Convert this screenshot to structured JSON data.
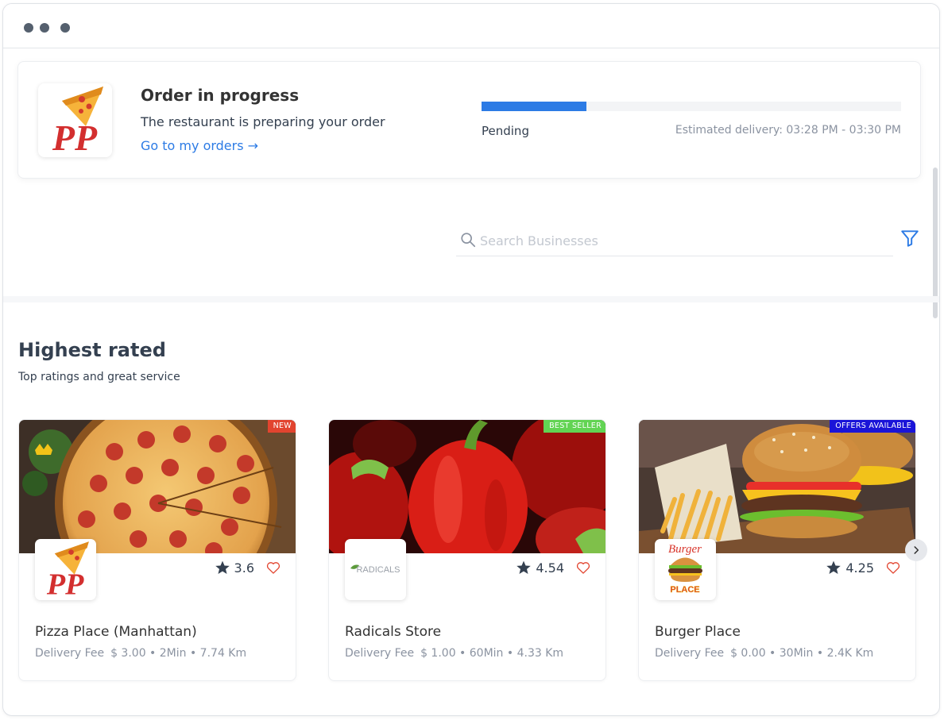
{
  "window": {
    "controls": [
      "window-dot-1",
      "window-dot-2",
      "window-dot-3"
    ]
  },
  "order": {
    "logo_text": "PP",
    "title": "Order in progress",
    "subtitle": "The restaurant is preparing your order",
    "link": "Go to my orders →",
    "progress": 0.25,
    "status": "Pending",
    "eta": "Estimated delivery: 03:28 PM - 03:30 PM",
    "colors": {
      "accent": "#2c7be5",
      "logo_red": "#d32f2f"
    }
  },
  "search": {
    "placeholder": "Search Businesses",
    "value": ""
  },
  "section": {
    "title": "Highest rated",
    "subtitle": "Top ratings and great service"
  },
  "businesses": [
    {
      "name": "Pizza Place (Manhattan)",
      "badge": "NEW",
      "badge_color": "#e2442f",
      "rating": "3.6",
      "fee_label": "Delivery Fee",
      "meta": "$ 3.00 • 2Min • 7.74 Km",
      "logo_text": "PP"
    },
    {
      "name": "Radicals Store",
      "badge": "BEST SELLER",
      "badge_color": "#62d453",
      "rating": "4.54",
      "fee_label": "Delivery Fee",
      "meta": "$ 1.00 • 60Min • 4.33 Km",
      "logo_text": "RADICALS"
    },
    {
      "name": "Burger Place",
      "badge": "OFFERS AVAILABLE",
      "badge_color": "#1a14d8",
      "rating": "4.25",
      "fee_label": "Delivery Fee",
      "meta": "$ 0.00 • 30Min • 2.4K Km",
      "logo_text": "Burger",
      "logo_text_2": "PLACE"
    }
  ]
}
